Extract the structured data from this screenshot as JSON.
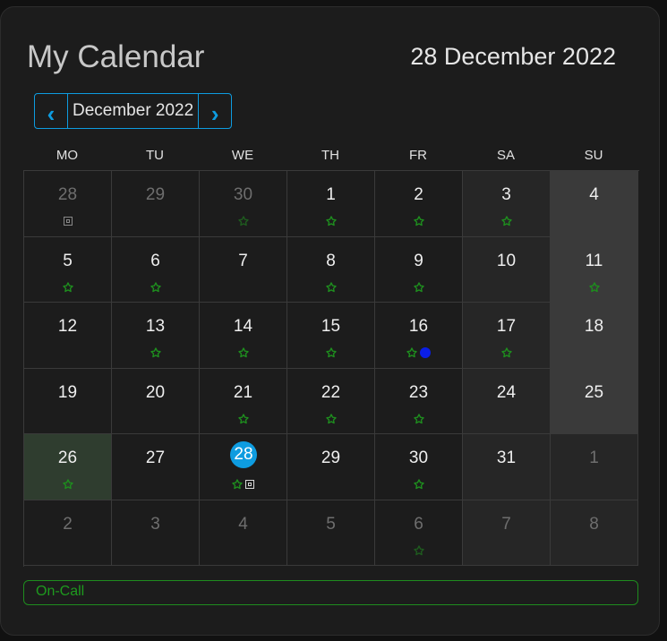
{
  "header": {
    "title": "My Calendar",
    "today": "28 December 2022"
  },
  "nav": {
    "month_label": "December 2022",
    "prev_label": "‹",
    "next_label": "›"
  },
  "weekdays": [
    "MO",
    "TU",
    "WE",
    "TH",
    "FR",
    "SA",
    "SU"
  ],
  "colors": {
    "accent": "#0e9ce0",
    "event_green": "#1e8c1e",
    "event_blue": "#0a1ee6"
  },
  "weeks": [
    [
      {
        "d": "28",
        "other": true,
        "marks": [
          "square-icon"
        ]
      },
      {
        "d": "29",
        "other": true,
        "marks": []
      },
      {
        "d": "30",
        "other": true,
        "marks": [
          "flower-icon"
        ]
      },
      {
        "d": "1",
        "marks": [
          "flower-icon"
        ]
      },
      {
        "d": "2",
        "marks": [
          "flower-icon"
        ]
      },
      {
        "d": "3",
        "marks": [
          "flower-icon"
        ]
      },
      {
        "d": "4",
        "marks": []
      }
    ],
    [
      {
        "d": "5",
        "marks": [
          "flower-icon"
        ]
      },
      {
        "d": "6",
        "marks": [
          "flower-icon"
        ]
      },
      {
        "d": "7",
        "marks": []
      },
      {
        "d": "8",
        "marks": [
          "flower-icon"
        ]
      },
      {
        "d": "9",
        "marks": [
          "flower-icon"
        ]
      },
      {
        "d": "10",
        "marks": []
      },
      {
        "d": "11",
        "marks": [
          "flower-icon"
        ]
      }
    ],
    [
      {
        "d": "12",
        "marks": []
      },
      {
        "d": "13",
        "marks": [
          "flower-icon"
        ]
      },
      {
        "d": "14",
        "marks": [
          "flower-icon"
        ]
      },
      {
        "d": "15",
        "marks": [
          "flower-icon"
        ]
      },
      {
        "d": "16",
        "marks": [
          "flower-icon",
          "dot-icon"
        ]
      },
      {
        "d": "17",
        "marks": [
          "flower-icon"
        ]
      },
      {
        "d": "18",
        "marks": []
      }
    ],
    [
      {
        "d": "19",
        "marks": []
      },
      {
        "d": "20",
        "marks": []
      },
      {
        "d": "21",
        "marks": [
          "flower-icon"
        ]
      },
      {
        "d": "22",
        "marks": [
          "flower-icon"
        ]
      },
      {
        "d": "23",
        "marks": [
          "flower-icon"
        ]
      },
      {
        "d": "24",
        "marks": []
      },
      {
        "d": "25",
        "marks": []
      }
    ],
    [
      {
        "d": "26",
        "holiday": true,
        "marks": [
          "flower-icon"
        ]
      },
      {
        "d": "27",
        "marks": []
      },
      {
        "d": "28",
        "today": true,
        "marks": [
          "flower-icon",
          "square-icon"
        ]
      },
      {
        "d": "29",
        "marks": []
      },
      {
        "d": "30",
        "marks": [
          "flower-icon"
        ]
      },
      {
        "d": "31",
        "marks": []
      },
      {
        "d": "1",
        "other": true,
        "marks": []
      }
    ],
    [
      {
        "d": "2",
        "other": true,
        "marks": []
      },
      {
        "d": "3",
        "other": true,
        "marks": []
      },
      {
        "d": "4",
        "other": true,
        "marks": []
      },
      {
        "d": "5",
        "other": true,
        "marks": []
      },
      {
        "d": "6",
        "other": true,
        "marks": [
          "flower-icon"
        ]
      },
      {
        "d": "7",
        "other": true,
        "marks": []
      },
      {
        "d": "8",
        "other": true,
        "marks": []
      }
    ]
  ],
  "legend": {
    "oncall_label": "On-Call"
  }
}
